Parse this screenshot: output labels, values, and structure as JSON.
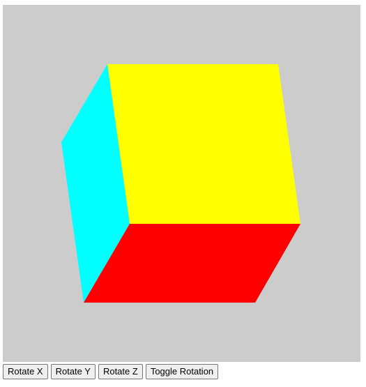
{
  "scene": {
    "background_color": "#cccccc",
    "faces": [
      {
        "name": "top-face",
        "color": "#ffff00"
      },
      {
        "name": "left-face",
        "color": "#00ffff"
      },
      {
        "name": "front-face",
        "color": "#ff0000"
      }
    ]
  },
  "controls": {
    "rotate_x_label": "Rotate X",
    "rotate_y_label": "Rotate Y",
    "rotate_z_label": "Rotate Z",
    "toggle_rotation_label": "Toggle Rotation"
  }
}
